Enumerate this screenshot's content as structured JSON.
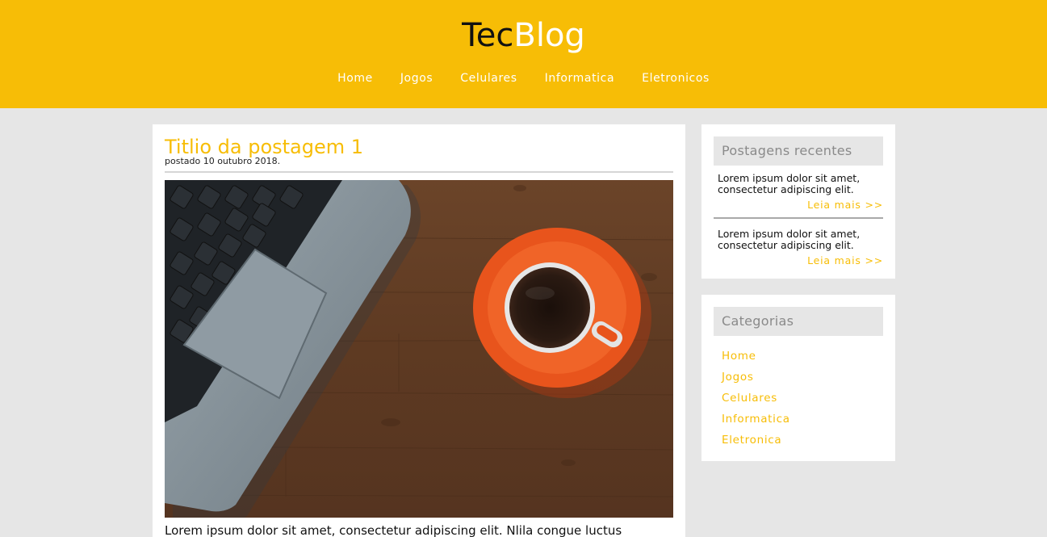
{
  "header": {
    "logo_part1": "Tec",
    "logo_part2": "Blog",
    "nav": [
      "Home",
      "Jogos",
      "Celulares",
      "Informatica",
      "Eletronicos"
    ]
  },
  "post": {
    "title": "Titlio da postagem 1",
    "date": "postado 10 outubro 2018.",
    "text": "Lorem ipsum dolor sit amet, consectetur adipiscing elit. Nlila congue luctus"
  },
  "sidebar": {
    "recent": {
      "heading": "Postagens recentes",
      "items": [
        {
          "text": "Lorem ipsum dolor sit amet, consectetur adipiscing elit.",
          "more": "Leia mais >>"
        },
        {
          "text": "Lorem ipsum dolor sit amet, consectetur adipiscing elit.",
          "more": "Leia mais >>"
        }
      ]
    },
    "categories": {
      "heading": "Categorias",
      "items": [
        "Home",
        "Jogos",
        "Celulares",
        "Informatica",
        "Eletronica"
      ]
    }
  },
  "colors": {
    "accent": "#f7bd06",
    "background": "#e6e6e6",
    "card": "#ffffff",
    "sidebar_heading_bg": "#e6e6e6",
    "sidebar_heading_text": "#8a8a8a"
  },
  "icons": [
    "laptop-coffee-photo"
  ]
}
